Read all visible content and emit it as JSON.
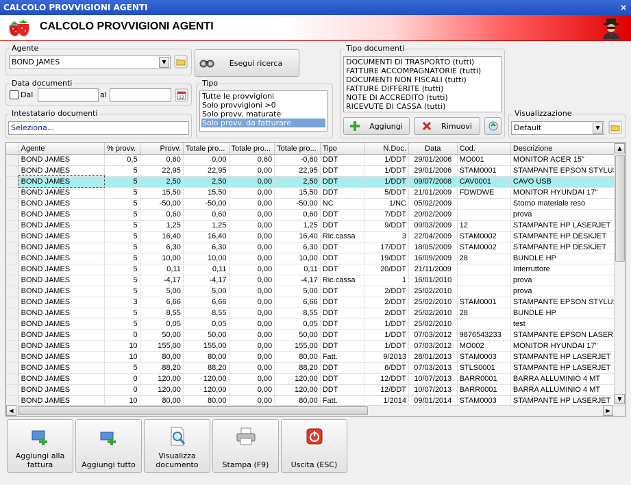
{
  "window": {
    "title": "CALCOLO PROVVIGIONI AGENTI",
    "close": "×"
  },
  "header": {
    "title": "CALCOLO PROVVIGIONI AGENTI"
  },
  "agente": {
    "label": "Agente",
    "value": "BOND JAMES"
  },
  "search_button": "Esegui ricerca",
  "data_documenti": {
    "label": "Data documenti",
    "dal": "Dal",
    "al": "al"
  },
  "intestatario": {
    "label": "Intestatario documenti",
    "value": "Seleziona..."
  },
  "tipo": {
    "label": "Tipo",
    "options": [
      "Tutte le provvigioni",
      "Solo provvigioni >0",
      "Solo provv. maturate",
      "Solo provv. da fatturare"
    ],
    "selected_index": 3
  },
  "tipo_documenti": {
    "label": "Tipo documenti",
    "items": [
      "DOCUMENTI DI TRASPORTO (tutti)",
      "FATTURE ACCOMPAGNATORIE (tutti)",
      "DOCUMENTI NON FISCALI (tutti)",
      "FATTURE DIFFERITE (tutti)",
      "NOTE DI ACCREDITO (tutti)",
      "RICEVUTE DI CASSA (tutti)"
    ],
    "add": "Aggiungi",
    "remove": "Rimuovi"
  },
  "visualizzazione": {
    "label": "Visualizzazione",
    "value": "Default"
  },
  "grid": {
    "columns": [
      "Agente",
      "% provv.",
      "Provv.",
      "Totale pro...",
      "Totale pro...",
      "Totale pro...",
      "Tipo",
      "N.Doc.",
      "Data",
      "Cod.",
      "Descrizione"
    ],
    "rows": [
      [
        "BOND JAMES",
        "0,5",
        "0,60",
        "0,00",
        "0,60",
        "-0,60",
        "DDT",
        "1/DDT",
        "29/01/2006",
        "MO001",
        "MONITOR ACER 15\""
      ],
      [
        "BOND JAMES",
        "5",
        "22,95",
        "22,95",
        "0,00",
        "22,95",
        "DDT",
        "1/DDT",
        "29/01/2006",
        "STAM0001",
        "STAMPANTE EPSON STYLUS"
      ],
      [
        "BOND JAMES",
        "5",
        "2,50",
        "2,50",
        "0,00",
        "2,50",
        "DDT",
        "1/DDT",
        "09/07/2008",
        "CAV0001",
        "CAVO USB"
      ],
      [
        "BOND JAMES",
        "5",
        "15,50",
        "15,50",
        "0,00",
        "15,50",
        "DDT",
        "5/DDT",
        "21/01/2009",
        "FDWDWE",
        "MONITOR HYUNDAI 17\""
      ],
      [
        "BOND JAMES",
        "5",
        "-50,00",
        "-50,00",
        "0,00",
        "-50,00",
        "NC",
        "1/NC",
        "05/02/2009",
        "",
        "Storno materiale reso"
      ],
      [
        "BOND JAMES",
        "5",
        "0,60",
        "0,60",
        "0,00",
        "0,60",
        "DDT",
        "7/DDT",
        "20/02/2009",
        "",
        "prova"
      ],
      [
        "BOND JAMES",
        "5",
        "1,25",
        "1,25",
        "0,00",
        "1,25",
        "DDT",
        "9/DDT",
        "09/03/2009",
        "12",
        "STAMPANTE HP LASERJET"
      ],
      [
        "BOND JAMES",
        "5",
        "16,40",
        "16,40",
        "0,00",
        "16,40",
        "Ric.cassa",
        "3",
        "22/04/2009",
        "STAM0002",
        "STAMPANTE HP DESKJET"
      ],
      [
        "BOND JAMES",
        "5",
        "6,30",
        "6,30",
        "0,00",
        "6,30",
        "DDT",
        "17/DDT",
        "18/05/2009",
        "STAM0002",
        "STAMPANTE HP DESKJET"
      ],
      [
        "BOND JAMES",
        "5",
        "10,00",
        "10,00",
        "0,00",
        "10,00",
        "DDT",
        "19/DDT",
        "16/09/2009",
        "28",
        "BUNDLE HP"
      ],
      [
        "BOND JAMES",
        "5",
        "0,11",
        "0,11",
        "0,00",
        "0,11",
        "DDT",
        "20/DDT",
        "21/11/2009",
        "",
        "Interruttore"
      ],
      [
        "BOND JAMES",
        "5",
        "-4,17",
        "-4,17",
        "0,00",
        "-4,17",
        "Ric.cassa",
        "1",
        "16/01/2010",
        "",
        "prova"
      ],
      [
        "BOND JAMES",
        "5",
        "5,00",
        "5,00",
        "0,00",
        "5,00",
        "DDT",
        "2/DDT",
        "25/02/2010",
        "",
        "prova"
      ],
      [
        "BOND JAMES",
        "3",
        "6,66",
        "6,66",
        "0,00",
        "6,66",
        "DDT",
        "2/DDT",
        "25/02/2010",
        "STAM0001",
        "STAMPANTE EPSON STYLUS"
      ],
      [
        "BOND JAMES",
        "5",
        "8,55",
        "8,55",
        "0,00",
        "8,55",
        "DDT",
        "2/DDT",
        "25/02/2010",
        "28",
        "BUNDLE HP"
      ],
      [
        "BOND JAMES",
        "5",
        "0,05",
        "0,05",
        "0,00",
        "0,05",
        "DDT",
        "1/DDT",
        "25/02/2010",
        "",
        "test"
      ],
      [
        "BOND JAMES",
        "0",
        "50,00",
        "50,00",
        "0,00",
        "50,00",
        "DDT",
        "1/DDT",
        "07/03/2012",
        "9876543233",
        "STAMPANTE EPSON LASER"
      ],
      [
        "BOND JAMES",
        "10",
        "155,00",
        "155,00",
        "0,00",
        "155,00",
        "DDT",
        "1/DDT",
        "07/03/2012",
        "MO002",
        "MONITOR HYUNDAI 17\""
      ],
      [
        "BOND JAMES",
        "10",
        "80,00",
        "80,00",
        "0,00",
        "80,00",
        "Fatt.",
        "9/2013",
        "28/01/2013",
        "STAM0003",
        "STAMPANTE HP LASERJET"
      ],
      [
        "BOND JAMES",
        "5",
        "88,20",
        "88,20",
        "0,00",
        "88,20",
        "DDT",
        "6/DDT",
        "07/03/2013",
        "STLS0001",
        "STAMPANTE HP LASERJET"
      ],
      [
        "BOND JAMES",
        "0",
        "120,00",
        "120,00",
        "0,00",
        "120,00",
        "DDT",
        "12/DDT",
        "10/07/2013",
        "BARR0001",
        "BARRA ALLUMINIO 4 MT"
      ],
      [
        "BOND JAMES",
        "0",
        "120,00",
        "120,00",
        "0,00",
        "120,00",
        "DDT",
        "12/DDT",
        "10/07/2013",
        "BARR0001",
        "BARRA ALLUMINIO 4 MT"
      ],
      [
        "BOND JAMES",
        "10",
        "80,00",
        "80,00",
        "0,00",
        "80,00",
        "Fatt.",
        "1/2014",
        "09/01/2014",
        "STAM0003",
        "STAMPANTE HP LASERJET"
      ]
    ],
    "highlighted_row": 2
  },
  "bottom_buttons": [
    {
      "label": "Aggiungi alla fattura",
      "icon": "add-to-invoice-icon"
    },
    {
      "label": "Aggiungi tutto",
      "icon": "add-all-icon"
    },
    {
      "label": "Visualizza documento",
      "icon": "view-document-icon"
    },
    {
      "label": "Stampa (F9)",
      "icon": "printer-icon"
    },
    {
      "label": "Uscita (ESC)",
      "icon": "power-icon"
    }
  ]
}
